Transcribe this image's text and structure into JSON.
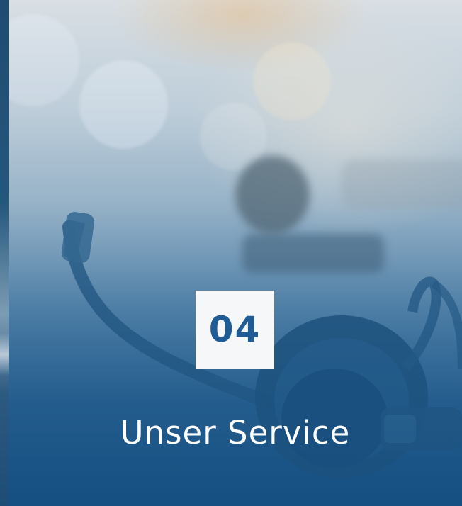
{
  "card": {
    "number": "04",
    "title": "Unser Service"
  },
  "colors": {
    "badge_background": "#f5f7f9",
    "badge_text": "#1f5c96",
    "title_text": "#ffffff",
    "overlay": "#1c5588"
  },
  "image": {
    "subject": "headset-photo"
  }
}
